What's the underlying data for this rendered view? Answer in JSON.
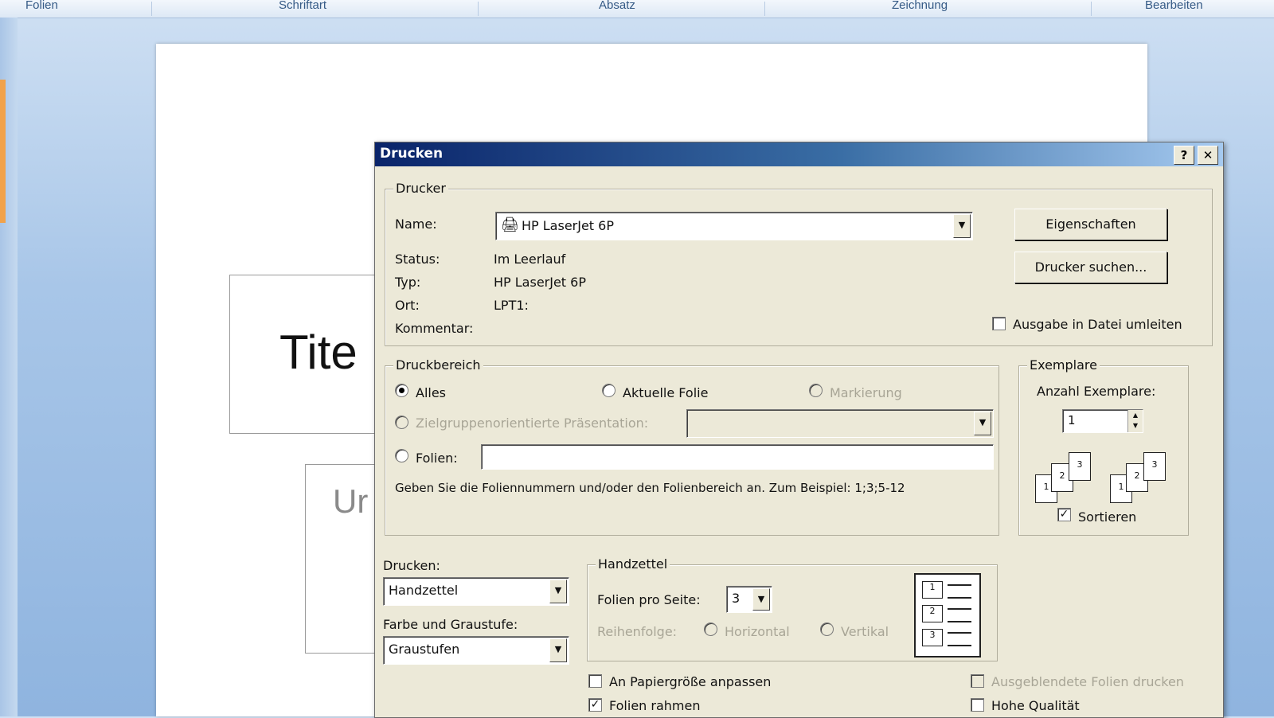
{
  "ribbon": {
    "groups": [
      "Folien",
      "Schriftart",
      "Absatz",
      "Zeichnung",
      "Bearbeiten"
    ]
  },
  "slide": {
    "title_placeholder": "Tite",
    "subtitle_placeholder": "Ur"
  },
  "dialog": {
    "title": "Drucken",
    "help_label": "?",
    "close_label": "✕",
    "printer": {
      "legend": "Drucker",
      "name_label": "Name:",
      "name_value": "HP LaserJet 6P",
      "status_label": "Status:",
      "status_value": "Im Leerlauf",
      "type_label": "Typ:",
      "type_value": "HP LaserJet 6P",
      "location_label": "Ort:",
      "location_value": "LPT1:",
      "comment_label": "Kommentar:",
      "properties_button": "Eigenschaften",
      "find_printer_button": "Drucker suchen...",
      "print_to_file_label": "Ausgabe in Datei umleiten"
    },
    "range": {
      "legend": "Druckbereich",
      "all_label": "Alles",
      "current_slide_label": "Aktuelle Folie",
      "selection_label": "Markierung",
      "custom_show_label": "Zielgruppenorientierte Präsentation:",
      "slides_label": "Folien:",
      "hint": "Geben Sie die Foliennummern und/oder den Folienbereich an. Zum Beispiel: 1;3;5-12"
    },
    "copies": {
      "legend": "Exemplare",
      "count_label": "Anzahl Exemplare:",
      "count_value": "1",
      "collate_label": "Sortieren",
      "collate_checked": true
    },
    "print_what": {
      "label": "Drucken:",
      "value": "Handzettel",
      "color_label": "Farbe und Graustufe:",
      "color_value": "Graustufen"
    },
    "handouts": {
      "legend": "Handzettel",
      "per_page_label": "Folien pro Seite:",
      "per_page_value": "3",
      "order_label": "Reihenfolge:",
      "horizontal_label": "Horizontal",
      "vertical_label": "Vertikal",
      "preview_numbers": [
        "1",
        "2",
        "3"
      ]
    },
    "options": {
      "scale_to_fit_label": "An Papiergröße anpassen",
      "frame_slides_label": "Folien rahmen",
      "hidden_slides_label": "Ausgeblendete Folien drucken",
      "high_quality_label": "Hohe Qualität"
    }
  }
}
